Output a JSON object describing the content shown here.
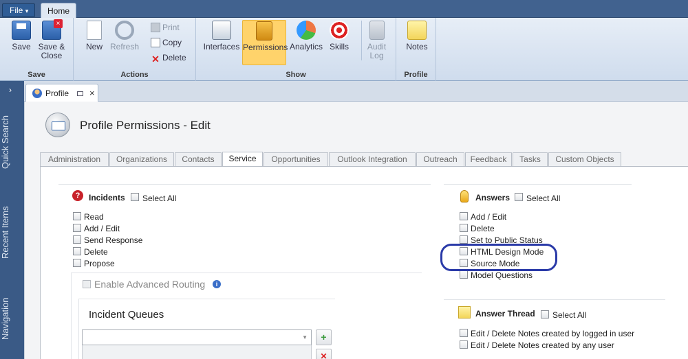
{
  "menu": {
    "file_label": "File",
    "file_arrow": "▾",
    "home_tab": "Home"
  },
  "ribbon": {
    "groups": {
      "save": {
        "label": "Save",
        "buttons": [
          {
            "label": "Save",
            "icon": "floppy-disk-icon"
          },
          {
            "label": "Save &",
            "label2": "Close",
            "icon": "save-close-icon"
          }
        ]
      },
      "actions": {
        "label": "Actions",
        "new_label": "New",
        "refresh_label": "Refresh",
        "print_label": "Print",
        "copy_label": "Copy",
        "delete_label": "Delete"
      },
      "show": {
        "label": "Show",
        "interfaces_label": "Interfaces",
        "permissions_label": "Permissions",
        "analytics_label": "Analytics",
        "skills_label": "Skills",
        "audit_label": "Audit",
        "audit_label2": "Log"
      },
      "profile": {
        "label": "Profile",
        "notes_label": "Notes"
      }
    },
    "active_button": "Permissions",
    "active_color": "#ffd36b"
  },
  "sidebar": {
    "expand_glyph": "›",
    "items": [
      {
        "label": "Quick Search"
      },
      {
        "label": "Recent Items"
      },
      {
        "label": "Navigation"
      }
    ]
  },
  "document_tab": {
    "label": "Profile",
    "close_glyph": "×"
  },
  "page": {
    "title": "Profile Permissions - Edit"
  },
  "section_tabs": [
    {
      "label": "Administration"
    },
    {
      "label": "Organizations"
    },
    {
      "label": "Contacts"
    },
    {
      "label": "Service",
      "selected": true
    },
    {
      "label": "Opportunities"
    },
    {
      "label": "Outlook Integration"
    },
    {
      "label": "Outreach"
    },
    {
      "label": "Feedback"
    },
    {
      "label": "Tasks"
    },
    {
      "label": "Custom Objects"
    }
  ],
  "incidents": {
    "title": "Incidents",
    "select_all": "Select All",
    "permissions": [
      {
        "label": "Read"
      },
      {
        "label": "Add / Edit"
      },
      {
        "label": "Send Response"
      },
      {
        "label": "Delete"
      },
      {
        "label": "Propose"
      }
    ],
    "advanced_routing": "Enable Advanced Routing",
    "info_glyph": "i",
    "queues_title": "Incident Queues",
    "dropdown_value": "",
    "dropdown_arrow": "▼",
    "add_glyph": "+",
    "remove_glyph": "✕"
  },
  "answers": {
    "title": "Answers",
    "select_all": "Select All",
    "permissions": [
      {
        "label": "Add / Edit"
      },
      {
        "label": "Delete"
      },
      {
        "label": "Set to Public Status"
      },
      {
        "label": "HTML Design Mode"
      },
      {
        "label": "Source Mode"
      },
      {
        "label": "Model Questions"
      }
    ]
  },
  "answer_thread": {
    "title": "Answer Thread",
    "select_all": "Select All",
    "permissions": [
      {
        "label": "Edit / Delete Notes created by logged in user"
      },
      {
        "label": "Edit / Delete Notes created by any user"
      }
    ]
  },
  "annotation": {
    "color": "#2a3aa8"
  }
}
